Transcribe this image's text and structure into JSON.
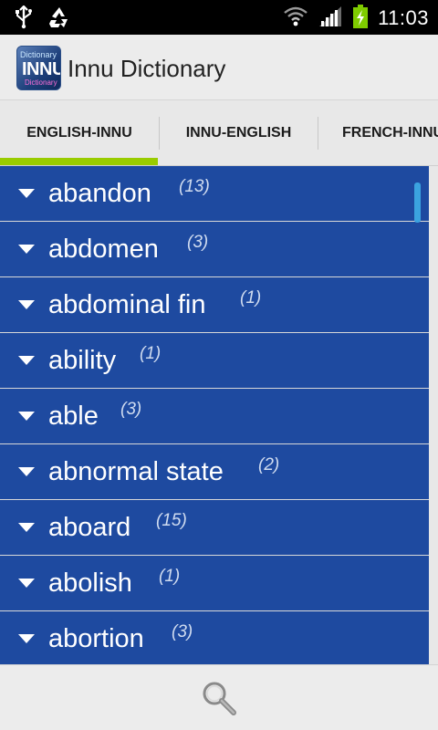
{
  "status_bar": {
    "time": "11:03",
    "icons": [
      "usb-icon",
      "recycle-icon",
      "wifi-icon",
      "signal-icon",
      "battery-charging-icon"
    ]
  },
  "app": {
    "title": "Innu Dictionary",
    "icon_text_top": "Dictionary",
    "icon_text_main": "INNU",
    "icon_text_bottom": "Dictionary"
  },
  "tabs": [
    {
      "label": "ENGLISH-INNU",
      "selected": true
    },
    {
      "label": "INNU-ENGLISH",
      "selected": false
    },
    {
      "label": "FRENCH-INNU",
      "selected": false
    }
  ],
  "colors": {
    "accent": "#99cc00",
    "list_background": "#1e4aa0",
    "scroll_thumb": "#3ba3e0"
  },
  "entries": [
    {
      "word": "abandon",
      "count": "(13)"
    },
    {
      "word": "abdomen",
      "count": "(3)"
    },
    {
      "word": "abdominal fin",
      "count": "(1)"
    },
    {
      "word": "ability",
      "count": "(1)"
    },
    {
      "word": "able",
      "count": "(3)"
    },
    {
      "word": "abnormal state",
      "count": "(2)"
    },
    {
      "word": "aboard",
      "count": "(15)"
    },
    {
      "word": "abolish",
      "count": "(1)"
    },
    {
      "word": "abortion",
      "count": "(3)"
    }
  ],
  "bottom_bar": {
    "icon": "search-icon"
  }
}
